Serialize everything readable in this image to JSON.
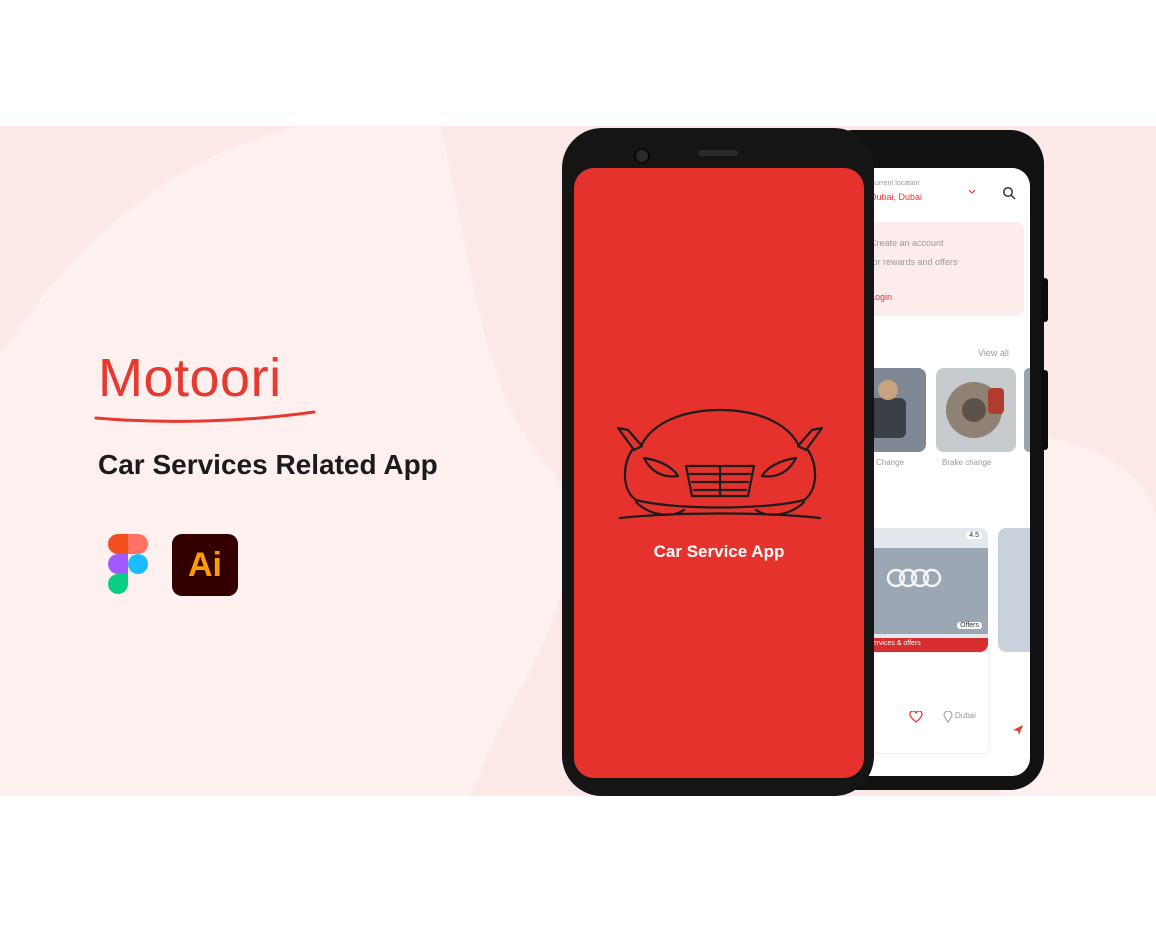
{
  "brand": {
    "name": "Motoori",
    "tagline": "Car Services Related App"
  },
  "tools": [
    {
      "name": "figma-icon"
    },
    {
      "name": "adobe-illustrator-icon",
      "label": "Ai"
    }
  ],
  "front_screen": {
    "splash_title": "Car Service App"
  },
  "back_screen": {
    "location_caption": "Current location",
    "location_value": "Dubai, Dubai",
    "promo_line1": "Create an account",
    "promo_line2": "for rewards and offers",
    "promo_link": "Login",
    "section_link": "View all",
    "services": [
      "Oil Change",
      "Brake change"
    ],
    "dealer_rating": "4.5",
    "dealer_badge": "Offers",
    "dealer_promo": "Services & offers",
    "nav_location": "Dubai"
  },
  "colors": {
    "brand_red": "#e53a30",
    "band_pink": "#fde8e8",
    "ai_bg": "#330000",
    "ai_text": "#ff9a00"
  }
}
